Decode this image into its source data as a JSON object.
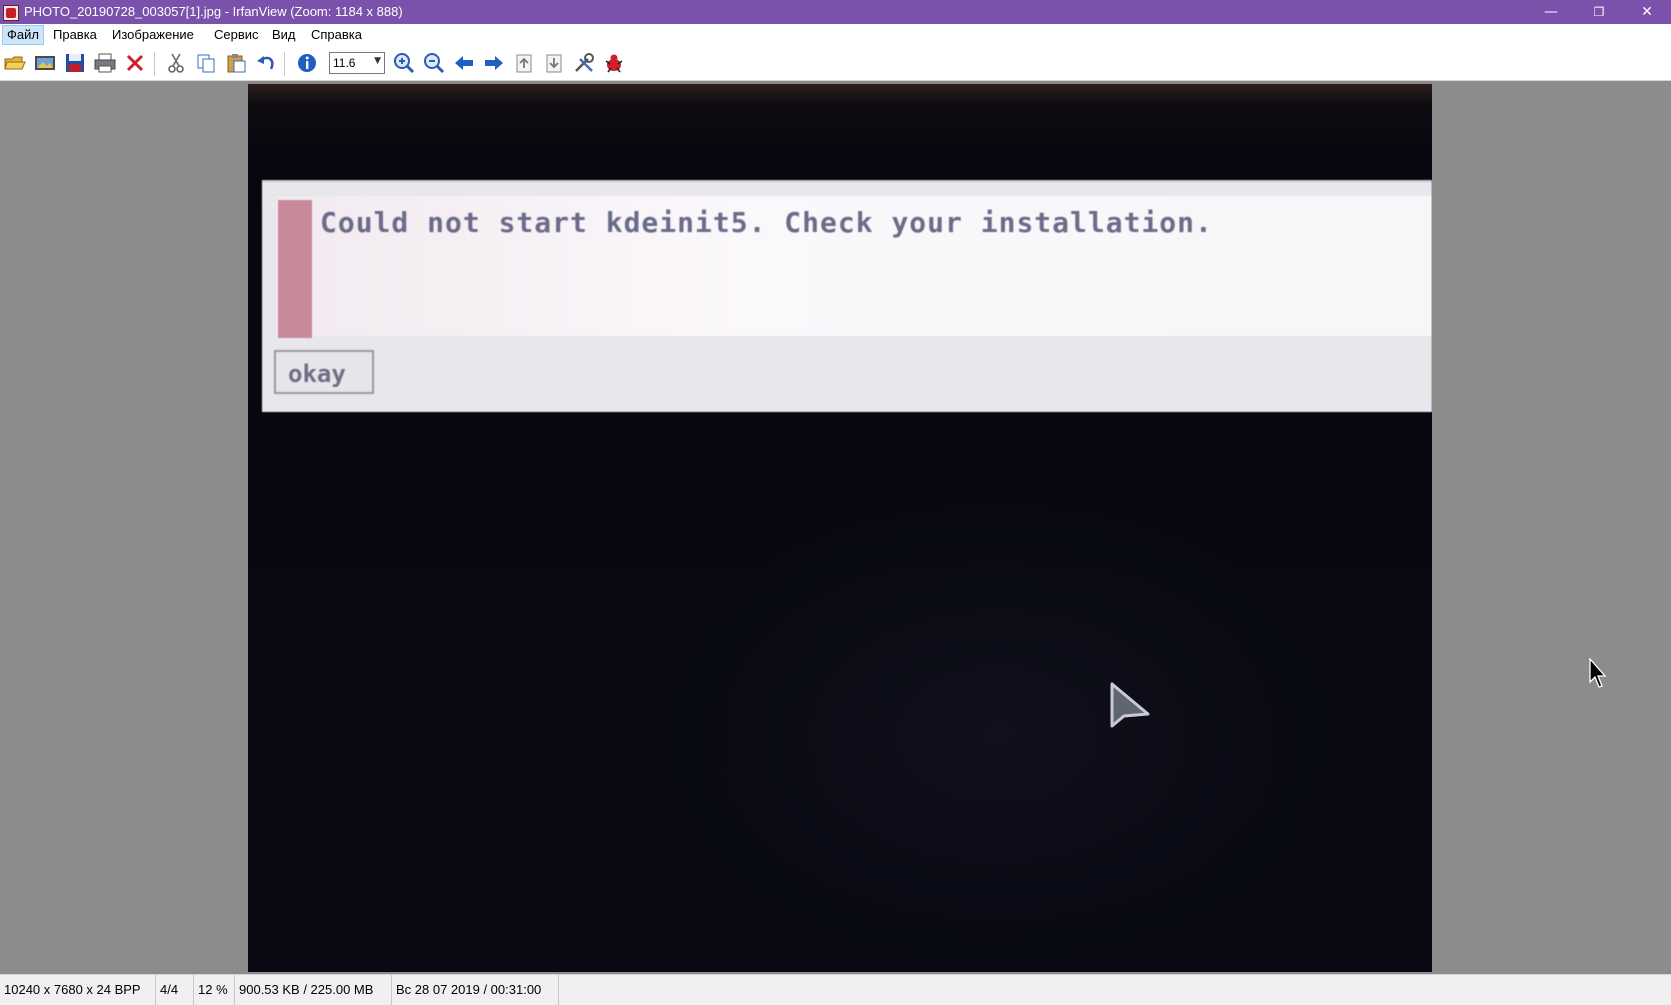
{
  "window": {
    "title": "PHOTO_20190728_003057[1].jpg - IrfanView (Zoom: 1184 x 888)",
    "minimize_glyph": "—",
    "restore_glyph": "❐",
    "close_glyph": "✕"
  },
  "menu": {
    "items": [
      "Файл",
      "Правка",
      "Изображение",
      "Сервис",
      "Вид",
      "Справка"
    ],
    "active_item": "Файл"
  },
  "toolbar": {
    "zoom_value": "11.6",
    "icons": [
      "open-icon",
      "slideshow-icon",
      "save-icon",
      "print-icon",
      "delete-icon",
      "cut-icon",
      "copy-icon",
      "paste-icon",
      "undo-icon",
      "info-icon",
      "zoom-in-icon",
      "zoom-out-icon",
      "previous-icon",
      "next-icon",
      "first-page-icon",
      "last-page-icon",
      "settings-icon",
      "irfanview-icon"
    ]
  },
  "image_content": {
    "dialog_message": "Could not start kdeinit5. Check your installation.",
    "dialog_button": "okay"
  },
  "status_bar": {
    "dimensions": "10240 x 7680 x 24 BPP",
    "index": "4/4",
    "zoom_percent": "12 %",
    "size": "900.53 KB / 225.00 MB",
    "date": "Вс 28 07 2019 / 00:31:00"
  },
  "colors": {
    "title_bar": "#7b52ab",
    "viewport_background": "#8c8c8c",
    "menu_active": "#cce4f7"
  }
}
